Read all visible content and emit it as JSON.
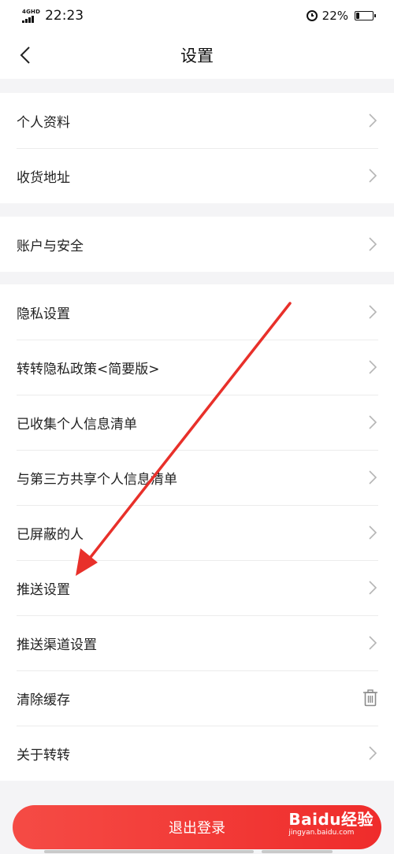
{
  "status_bar": {
    "network": "4GHD",
    "time": "22:23",
    "battery_percent": "22%",
    "battery_level": 0.22
  },
  "nav": {
    "title": "设置"
  },
  "sections": [
    {
      "items": [
        {
          "label": "个人资料"
        },
        {
          "label": "收货地址"
        }
      ]
    },
    {
      "items": [
        {
          "label": "账户与安全"
        }
      ]
    },
    {
      "items": [
        {
          "label": "隐私设置"
        },
        {
          "label": "转转隐私政策<简要版>"
        },
        {
          "label": "已收集个人信息清单"
        },
        {
          "label": "与第三方共享个人信息清单"
        },
        {
          "label": "已屏蔽的人"
        },
        {
          "label": "推送设置"
        },
        {
          "label": "推送渠道设置"
        },
        {
          "label": "清除缓存"
        },
        {
          "label": "关于转转"
        }
      ]
    }
  ],
  "logout_label": "退出登录",
  "watermark": {
    "logo": "Baidu经验",
    "sub": "jingyan.baidu.com"
  },
  "colors": {
    "accent": "#ef2c2b",
    "annotation_arrow": "#e8302a",
    "background": "#f4f4f6"
  }
}
